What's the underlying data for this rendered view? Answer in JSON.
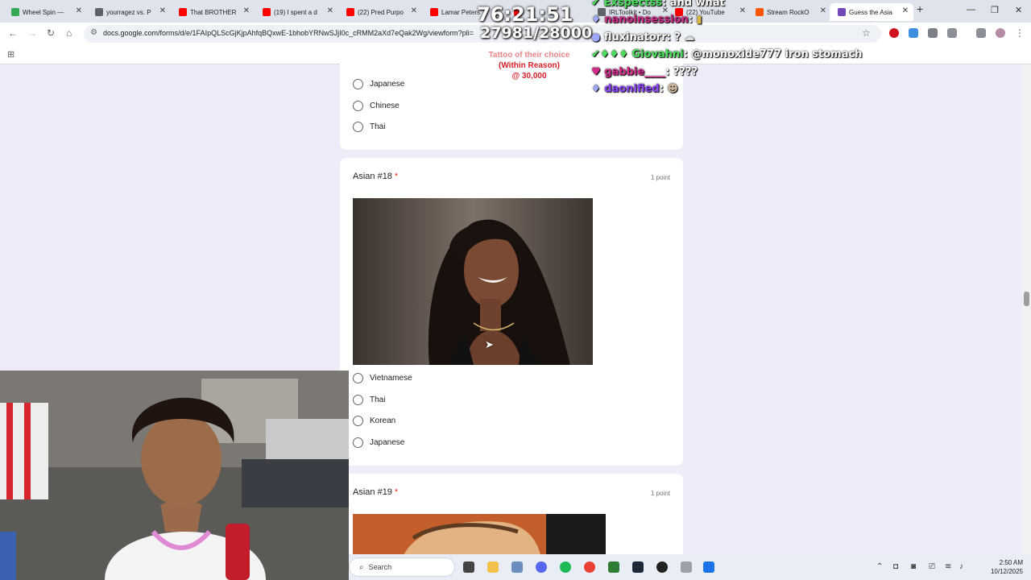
{
  "browser": {
    "tabs": [
      {
        "label": "Wheel Spin —",
        "color": "#34a853"
      },
      {
        "label": "yourragez vs. P",
        "color": "#5f6368"
      },
      {
        "label": "That BROTHER",
        "color": "#ff0000"
      },
      {
        "label": "(19) I spent a d",
        "color": "#ff0000"
      },
      {
        "label": "(22) Pred Purpo",
        "color": "#ff0000"
      },
      {
        "label": "Lamar Peters",
        "color": "#ff0000"
      },
      {
        "label": "",
        "color": "#ff0000"
      },
      {
        "label": "IRLToolkit • Do",
        "color": "#5f6368"
      },
      {
        "label": "(22) YouTube",
        "color": "#ff0000"
      },
      {
        "label": "Stream RockO",
        "color": "#ff5500"
      },
      {
        "label": "Guess the Asia",
        "color": "#7248b9"
      }
    ],
    "new_tab_label": "+",
    "url": "docs.google.com/forms/d/e/1FAIpQLScGjKjpAhfqBQxwE-1bhobYRNwSJjI0c_cRMM2aXd7eQak2Wg/viewform?pli="
  },
  "overlay": {
    "timer": "76:21:51",
    "sub_count": "27981/28000",
    "goal_lines": [
      "Tattoo of their choice",
      "(Within Reason)",
      "@ 30,000"
    ],
    "chat": [
      {
        "user": "Exspectss",
        "message": ": and what",
        "color": "#48e05a"
      },
      {
        "user": "nanoinsession",
        "message": ":",
        "color": "#d42a8a"
      },
      {
        "user": "fluxinatorr",
        "message": ": ?",
        "color": "#ffffff"
      },
      {
        "user": "Giovahni",
        "message": ": @monoxide777 iron stomach",
        "color": "#48e05a"
      },
      {
        "user": "gabbie____",
        "message": ": ????",
        "color": "#d42a8a"
      },
      {
        "user": "daonified",
        "message": ":",
        "color": "#9146ff"
      }
    ]
  },
  "form": {
    "prev_options": [
      "Japanese",
      "Chinese",
      "Thai"
    ],
    "q18": {
      "title": "Asian #18",
      "required_mark": "*",
      "points": "1 point",
      "options": [
        "Vietnamese",
        "Thai",
        "Korean",
        "Japanese"
      ]
    },
    "q19": {
      "title": "Asian #19",
      "required_mark": "*",
      "points": "1 point"
    }
  },
  "taskbar": {
    "search_label": "Search",
    "time": "2:50 AM",
    "date": "10/12/2025"
  }
}
